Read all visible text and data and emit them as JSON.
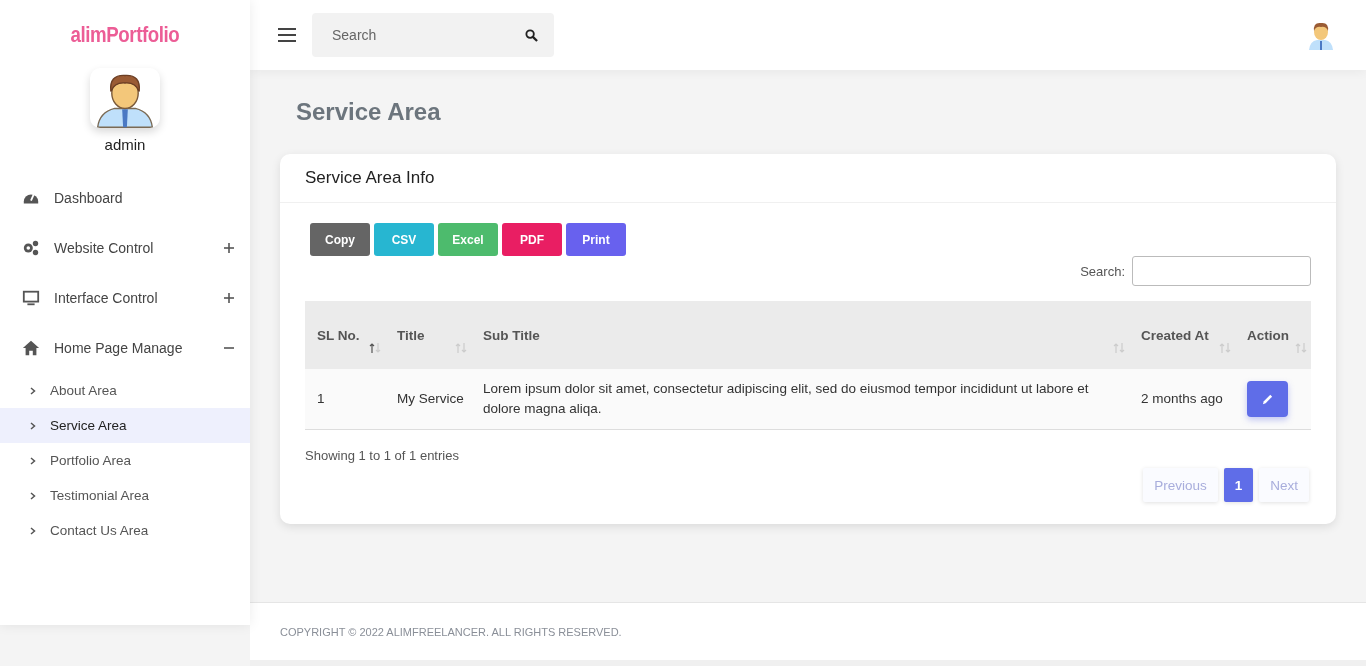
{
  "brand": "alimPortfolio",
  "topbar": {
    "search": {
      "placeholder": "Search"
    }
  },
  "profile": {
    "name": "admin"
  },
  "sidebar": {
    "items": [
      {
        "label": "Dashboard",
        "kind": "link"
      },
      {
        "label": "Website Control",
        "kind": "group",
        "expanded": false
      },
      {
        "label": "Interface Control",
        "kind": "group",
        "expanded": false
      },
      {
        "label": "Home Page Manage",
        "kind": "group",
        "expanded": true,
        "children": [
          {
            "label": "About Area",
            "selected": false
          },
          {
            "label": "Service Area",
            "selected": true
          },
          {
            "label": "Portfolio Area",
            "selected": false
          },
          {
            "label": "Testimonial Area",
            "selected": false
          },
          {
            "label": "Contact Us Area",
            "selected": false
          }
        ]
      }
    ]
  },
  "page_title": "Service Area",
  "card": {
    "title": "Service Area Info",
    "export_buttons": [
      {
        "label": "Copy",
        "color": "#656565"
      },
      {
        "label": "CSV",
        "color": "#27b6d1"
      },
      {
        "label": "Excel",
        "color": "#4dbb6d"
      },
      {
        "label": "PDF",
        "color": "#e91e63"
      },
      {
        "label": "Print",
        "color": "#6861ee"
      }
    ],
    "search_label": "Search:",
    "table": {
      "columns": [
        {
          "label": "SL No.",
          "sorted": true
        },
        {
          "label": "Title",
          "sorted": false
        },
        {
          "label": "Sub Title",
          "sorted": false
        },
        {
          "label": "Created At",
          "sorted": false
        },
        {
          "label": "Action",
          "sorted": false
        }
      ],
      "rows": [
        {
          "sl": "1",
          "title": "My Service",
          "subtitle": "Lorem ipsum dolor sit amet, consectetur adipiscing elit, sed do eiusmod tempor incididunt ut labore et dolore magna aliqa.",
          "created": "2 months ago"
        }
      ]
    },
    "info": "Showing 1 to 1 of 1 entries",
    "pagination": {
      "previous": {
        "label": "Previous",
        "disabled": true
      },
      "pages": [
        {
          "label": "1",
          "selected": true
        }
      ],
      "next": {
        "label": "Next",
        "disabled": true
      }
    }
  },
  "footer": "COPYRIGHT © 2022 ALIMFREELANCER. ALL RIGHTS RESERVED."
}
